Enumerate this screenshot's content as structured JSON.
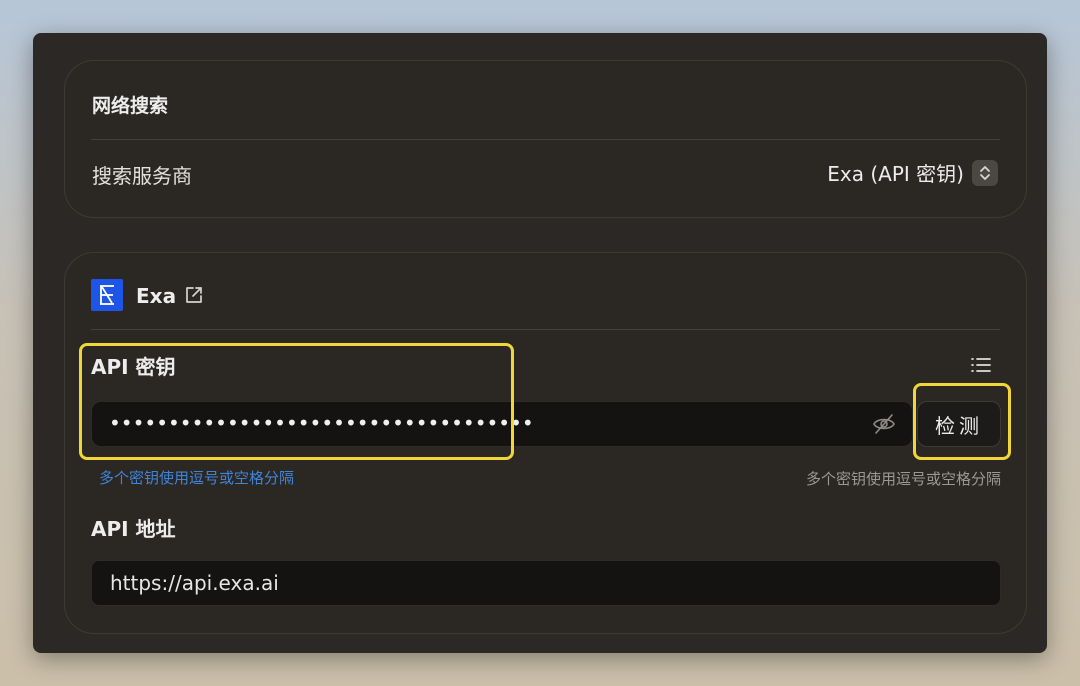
{
  "web_search": {
    "title": "网络搜索",
    "provider_label": "搜索服务商",
    "provider_value": "Exa (API 密钥)"
  },
  "exa": {
    "name": "Exa",
    "logo_color": "#1f55e6",
    "api_key": {
      "label": "API 密钥",
      "value": "••••••••••••••••••••••••••••••••••••",
      "check_label": "检测",
      "hint_link": "多个密钥使用逗号或空格分隔",
      "hint_text": "多个密钥使用逗号或空格分隔"
    },
    "api_url": {
      "label": "API 地址",
      "value": "https://api.exa.ai"
    }
  },
  "icons": [
    "chevron-updown-icon",
    "exa-logo-icon",
    "external-link-icon",
    "list-icon",
    "eye-off-icon"
  ],
  "colors": {
    "highlight": "#f1d63a",
    "link": "#3f84d9",
    "panel": "#2c2825"
  }
}
